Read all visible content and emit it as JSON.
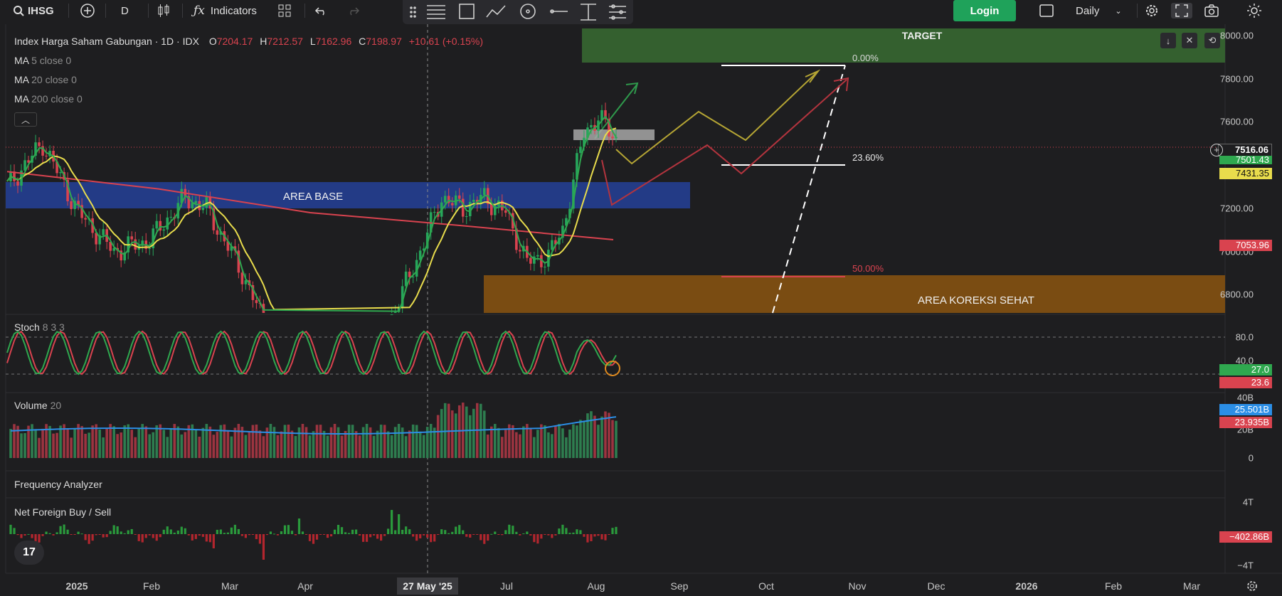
{
  "toolbar": {
    "symbol": "IHSG",
    "interval": "D",
    "indicators_label": "Indicators",
    "login_label": "Login",
    "timeframe": "Daily"
  },
  "legend": {
    "title": "Index Harga Saham Gabungan · 1D · IDX",
    "ohlc": {
      "o_label": "O",
      "o": "7204.17",
      "h_label": "H",
      "h": "7212.57",
      "l_label": "L",
      "l": "7162.96",
      "c_label": "C",
      "c": "7198.97",
      "change": "+10.61 (+0.15%)"
    },
    "ma5": {
      "name": "MA",
      "params": "5 close 0"
    },
    "ma20": {
      "name": "MA",
      "params": "20 close 0"
    },
    "ma200": {
      "name": "MA",
      "params": "200 close 0"
    }
  },
  "panels": {
    "stoch": {
      "name": "Stoch",
      "params": "8 3 3"
    },
    "volume": {
      "name": "Volume",
      "params": "20"
    },
    "frequency": {
      "name": "Frequency Analyzer"
    },
    "netforeign": {
      "name": "Net Foreign Buy / Sell"
    }
  },
  "price_tags": {
    "current": "7516.06",
    "ma5": "7501.43",
    "ma20": "7431.35",
    "ma200": "7053.96",
    "stoch_k": "27.0",
    "stoch_d": "23.6",
    "vol_ma": "25.501B",
    "vol": "23.935B",
    "nf": "−402.86B"
  },
  "crosshair_label": "27 May '25",
  "tv_logo": "17",
  "colors": {
    "up": "#26a65b",
    "down": "#d9434f",
    "ma5": "#2fa84f",
    "ma20": "#e8dc4c",
    "ma200": "#d9434f",
    "bg": "#1e1e20"
  },
  "chart_data": {
    "type": "line",
    "title": "Index Harga Saham Gabungan · 1D · IDX",
    "price_axis": {
      "ticks": [
        "8000.00",
        "7800.00",
        "7600.00",
        "7200.00",
        "7000.00",
        "6800.00"
      ],
      "ylim": [
        6716,
        8052
      ]
    },
    "stoch_axis": {
      "ticks": [
        "80.0",
        "40.0"
      ]
    },
    "volume_axis": {
      "ticks": [
        "40B",
        "20B",
        "0"
      ]
    },
    "nf_axis": {
      "ticks": [
        "4T",
        "−4T"
      ]
    },
    "x_ticks": [
      "2025",
      "Feb",
      "Mar",
      "Apr",
      "Jul",
      "Aug",
      "Sep",
      "Oct",
      "Nov",
      "Dec",
      "2026",
      "Feb",
      "Mar"
    ],
    "series": [
      {
        "name": "MA 200",
        "x": [
          "2025-01-01",
          "2025-03-01",
          "2025-05-01",
          "2025-06-15",
          "2025-08-10"
        ],
        "values": [
          7370,
          7290,
          7180,
          7120,
          7055
        ]
      }
    ],
    "zones": [
      {
        "label": "TARGET",
        "from": 7920,
        "to": 8052
      },
      {
        "label": "AREA BASE",
        "from": 7240,
        "to": 7345
      },
      {
        "label": "AREA KOREKSI SEHAT",
        "from": 6716,
        "to": 6900
      }
    ],
    "fib_levels": [
      {
        "label": "0.00%",
        "value": 7920
      },
      {
        "label": "23.60%",
        "value": 7470
      },
      {
        "label": "50.00%",
        "value": 6900
      }
    ],
    "last_close": 7516.06,
    "legend_position": "top-left",
    "grid": false
  }
}
